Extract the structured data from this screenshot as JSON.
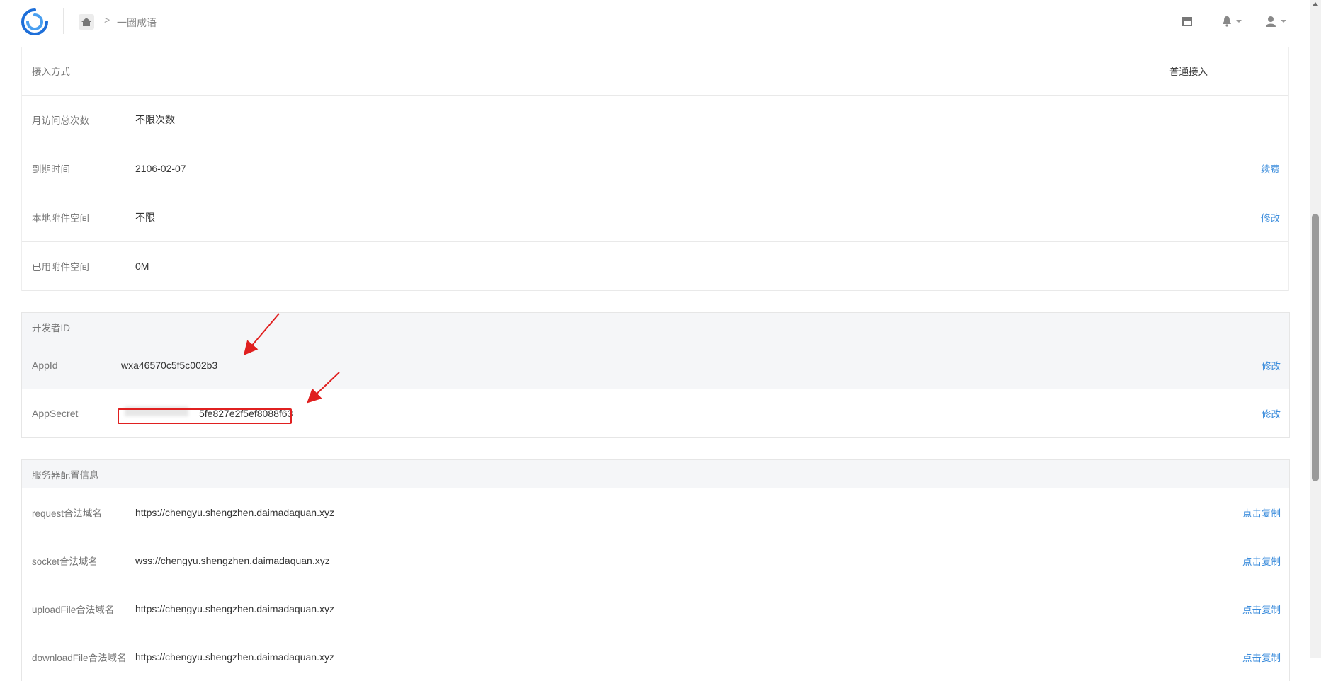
{
  "header": {
    "breadcrumb": "一圈成语",
    "home_icon": "home-icon",
    "store_icon": "store-icon",
    "bell_icon": "bell-icon",
    "user_icon": "user-icon"
  },
  "info_rows": [
    {
      "label": "接入方式",
      "value": "",
      "right_text": "普通接入",
      "link": ""
    },
    {
      "label": "月访问总次数",
      "value": "不限次数",
      "right_text": "",
      "link": ""
    },
    {
      "label": "到期时间",
      "value": "2106-02-07",
      "right_text": "",
      "link": "续费"
    },
    {
      "label": "本地附件空间",
      "value": "不限",
      "right_text": "",
      "link": "修改"
    },
    {
      "label": "已用附件空间",
      "value": "0M",
      "right_text": "",
      "link": ""
    }
  ],
  "developer": {
    "title": "开发者ID",
    "appid_label": "AppId",
    "appid_value": "wxa46570c5f5c002b3",
    "appid_link": "修改",
    "secret_label": "AppSecret",
    "secret_value": "5fe827e2f5ef8088f63",
    "secret_link": "修改"
  },
  "server": {
    "title": "服务器配置信息",
    "rows": [
      {
        "label": "request合法域名",
        "value": "https://chengyu.shengzhen.daimadaquan.xyz",
        "link": "点击复制"
      },
      {
        "label": "socket合法域名",
        "value": "wss://chengyu.shengzhen.daimadaquan.xyz",
        "link": "点击复制"
      },
      {
        "label": "uploadFile合法域名",
        "value": "https://chengyu.shengzhen.daimadaquan.xyz",
        "link": "点击复制"
      },
      {
        "label": "downloadFile合法域名",
        "value": "https://chengyu.shengzhen.daimadaquan.xyz",
        "link": "点击复制"
      }
    ]
  },
  "colors": {
    "link": "#3c8ddc",
    "annotation": "#e02020",
    "panel_header": "#f5f6f8"
  }
}
